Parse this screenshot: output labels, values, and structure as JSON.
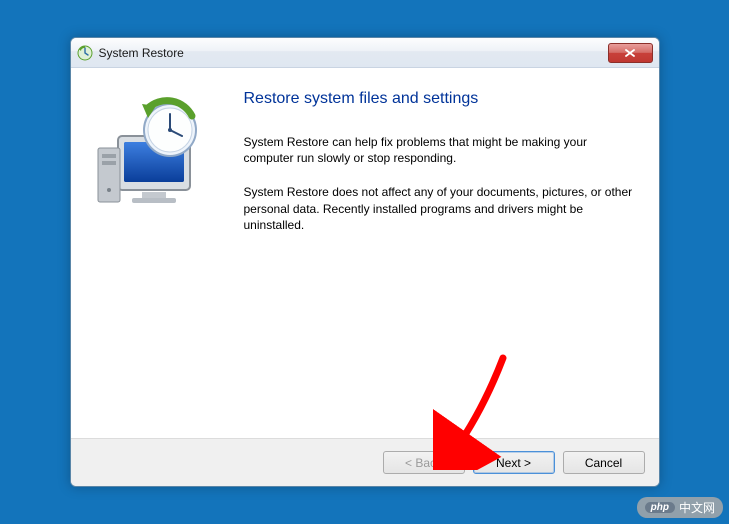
{
  "titlebar": {
    "title": "System Restore"
  },
  "content": {
    "heading": "Restore system files and settings",
    "para1": "System Restore can help fix problems that might be making your computer run slowly or stop responding.",
    "para2": "System Restore does not affect any of your documents, pictures, or other personal data. Recently installed programs and drivers might be uninstalled."
  },
  "buttons": {
    "back": "< Back",
    "next": "Next >",
    "cancel": "Cancel"
  },
  "watermark": {
    "badge": "php",
    "text": "中文网"
  }
}
